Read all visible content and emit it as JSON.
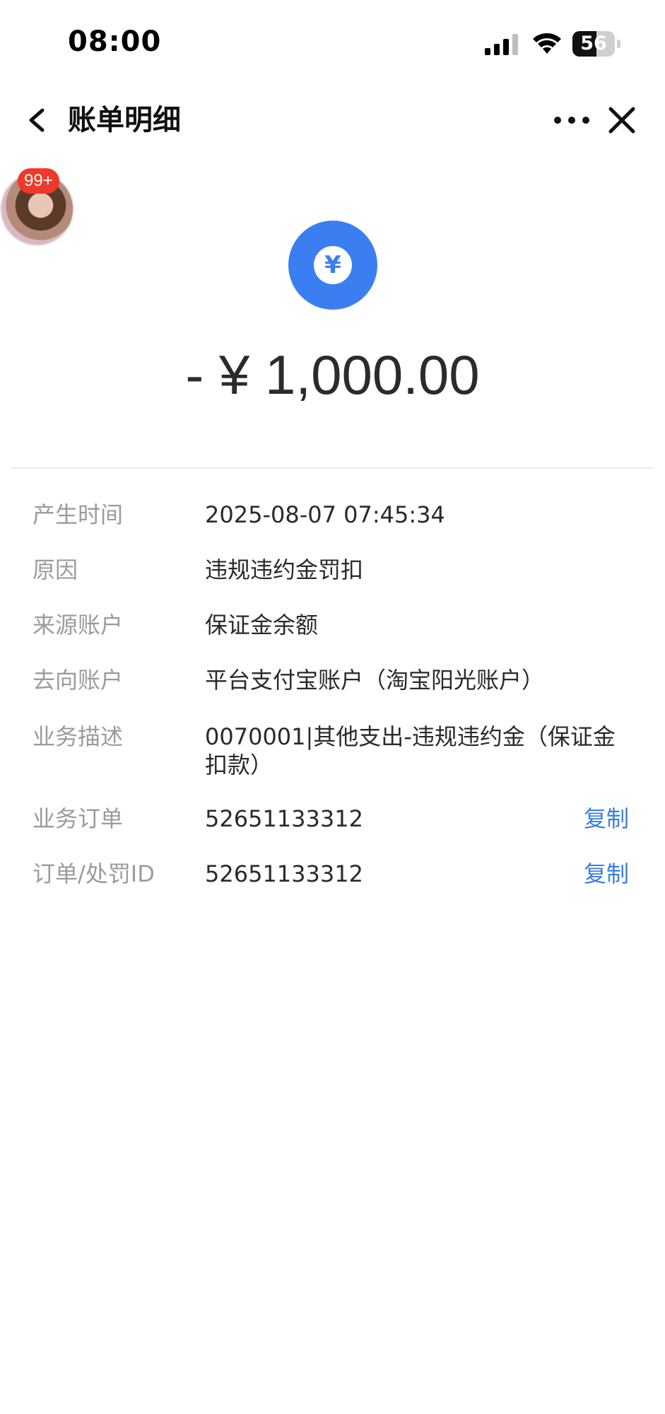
{
  "status_bar": {
    "time": "08:00",
    "battery_level": "56",
    "battery_fraction": 0.56,
    "icons": [
      "signal-icon",
      "wifi-icon",
      "battery-icon"
    ]
  },
  "nav": {
    "title": "账单明细",
    "icons": [
      "back-arrow-icon",
      "more-icon",
      "close-icon"
    ]
  },
  "avatar": {
    "badge": "99+"
  },
  "amount": {
    "icon_glyph": "¥",
    "value": "- ¥ 1,000.00",
    "icon_color": "#3b7ef2"
  },
  "details": {
    "time": {
      "label": "产生时间",
      "value": "2025-08-07 07:45:34"
    },
    "reason": {
      "label": "原因",
      "value": "违规违约金罚扣"
    },
    "source": {
      "label": "来源账户",
      "value": "保证金余额"
    },
    "destination": {
      "label": "去向账户",
      "value": "平台支付宝账户（淘宝阳光账户）"
    },
    "description": {
      "label": "业务描述",
      "value": "0070001|其他支出-违规违约金（保证金扣款）"
    },
    "order": {
      "label": "业务订单",
      "value": "52651133312",
      "copy_label": "复制"
    },
    "penalty_id": {
      "label": "订单/处罚ID",
      "value": "52651133312",
      "copy_label": "复制"
    }
  },
  "colors": {
    "accent": "#3a7ee0",
    "badge": "#f0392b",
    "label": "#9b9b9b"
  }
}
